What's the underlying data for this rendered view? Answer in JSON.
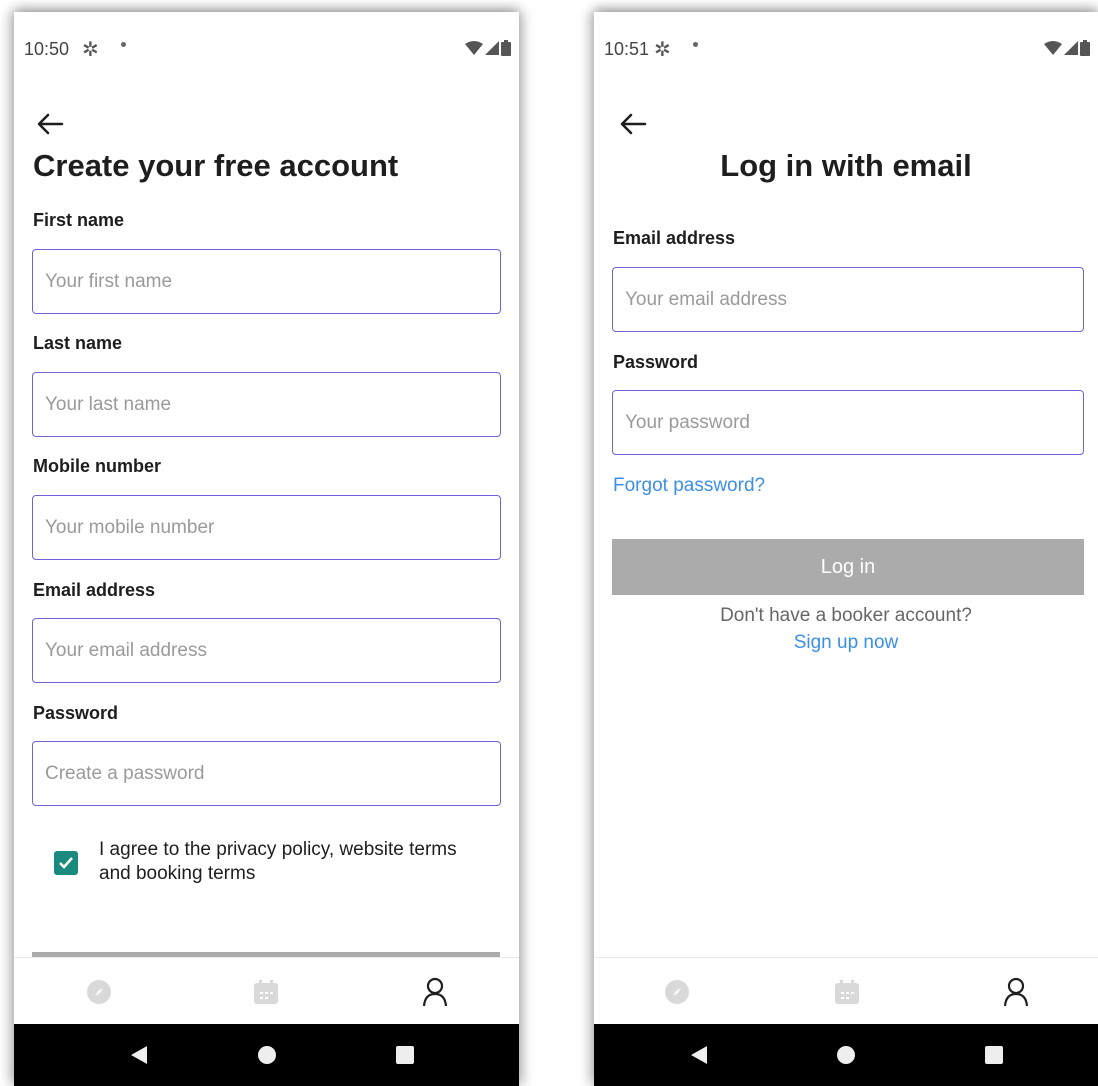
{
  "signup_screen": {
    "status_time": "10:50",
    "title": "Create your free account",
    "first_name": {
      "label": "First name",
      "placeholder": "Your first name"
    },
    "last_name": {
      "label": "Last name",
      "placeholder": "Your last name"
    },
    "mobile": {
      "label": "Mobile number",
      "placeholder": "Your mobile number"
    },
    "email": {
      "label": "Email address",
      "placeholder": "Your email address"
    },
    "password": {
      "label": "Password",
      "placeholder": "Create a password"
    },
    "agree_checked": true,
    "agree_text": "I agree to the privacy policy, website terms and booking terms"
  },
  "login_screen": {
    "status_time": "10:51",
    "title": "Log in with email",
    "email": {
      "label": "Email address",
      "placeholder": "Your email address"
    },
    "password": {
      "label": "Password",
      "placeholder": "Your password"
    },
    "forgot_link": "Forgot password?",
    "login_button": "Log in",
    "signup_prompt": "Don't have a booker account?",
    "signup_link": "Sign up now"
  },
  "bottom_nav": {
    "items": [
      {
        "icon": "compass-icon",
        "active": false
      },
      {
        "icon": "calendar-icon",
        "active": false
      },
      {
        "icon": "profile-icon",
        "active": true
      }
    ]
  },
  "colors": {
    "input_border": "#6f63d9",
    "link": "#3b8fe8",
    "checkbox": "#1b8a7e",
    "disabled_button": "#ababab"
  }
}
